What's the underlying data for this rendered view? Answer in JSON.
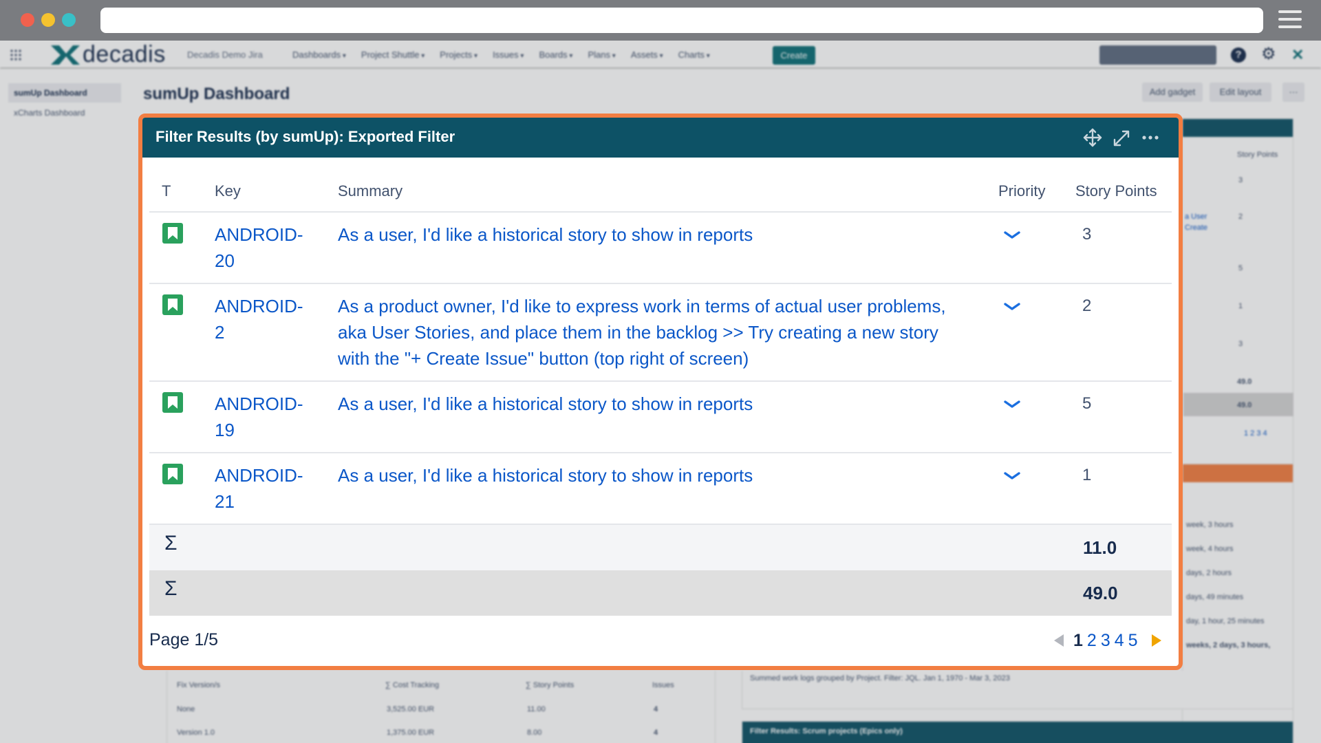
{
  "jira": {
    "logo_text": "decadis",
    "site_name": "Decadis Demo Jira",
    "nav": [
      "Dashboards",
      "Project Shuttle",
      "Projects",
      "Issues",
      "Boards",
      "Plans",
      "Assets",
      "Charts"
    ],
    "create_label": "Create",
    "sidebar": [
      "sumUp Dashboard",
      "xCharts Dashboard"
    ],
    "dashboard_title": "sumUp Dashboard",
    "add_gadget_label": "Add gadget",
    "edit_layout_label": "Edit layout",
    "more_label": "···"
  },
  "background": {
    "right_top": {
      "header": "Story Points",
      "user_link": [
        "a User",
        "Create"
      ],
      "values": [
        "3",
        "2",
        "5",
        "1",
        "3"
      ],
      "sums": [
        "49.0",
        "49.0"
      ],
      "pages": "1 2 3 4"
    },
    "right_mid": {
      "lines": [
        "week, 3 hours",
        "week, 4 hours",
        "days, 2 hours",
        "days, 49 minutes",
        "day, 1 hour, 25 minutes",
        "weeks, 2 days, 3 hours,"
      ],
      "caption": "Summed work logs grouped by Project. Filter: JQL. Jan 1, 1970 - Mar 3, 2023"
    },
    "right_bottom_title": "Filter Results: Scrum projects (Epics only)",
    "bottom_left": {
      "headers": [
        "Fix Version/s",
        "∑ Cost Tracking",
        "∑ Story Points",
        "Issues"
      ],
      "rows": [
        [
          "None",
          "3,525.00 EUR",
          "11.00",
          "4"
        ],
        [
          "Version 1.0",
          "1,375.00 EUR",
          "8.00",
          "4"
        ]
      ]
    }
  },
  "gadget": {
    "title": "Filter Results (by sumUp): Exported Filter",
    "columns": {
      "type": "T",
      "key": "Key",
      "summary": "Summary",
      "priority": "Priority",
      "story_points": "Story Points"
    },
    "rows": [
      {
        "key": "ANDROID-20",
        "summary": "As a user, I'd like a historical story to show in reports",
        "points": "3"
      },
      {
        "key": "ANDROID-2",
        "summary": "As a product owner, I'd like to express work in terms of actual user problems, aka User Stories, and place them in the backlog >> Try creating a new story with the \"+ Create Issue\" button (top right of screen)",
        "points": "2"
      },
      {
        "key": "ANDROID-19",
        "summary": "As a user, I'd like a historical story to show in reports",
        "points": "5"
      },
      {
        "key": "ANDROID-21",
        "summary": "As a user, I'd like a historical story to show in reports",
        "points": "1"
      }
    ],
    "sum_symbol": "Σ",
    "page_sum": "11.0",
    "total_sum": "49.0",
    "page_label": "Page 1/5",
    "pages": [
      "1",
      "2",
      "3",
      "4",
      "5"
    ],
    "current_page": "1"
  },
  "colors": {
    "header_bg": "#0d5266",
    "highlight_border": "#f27e42",
    "link": "#0b57c8",
    "story_icon": "#2aa15d",
    "next_arrow": "#f0a400"
  }
}
